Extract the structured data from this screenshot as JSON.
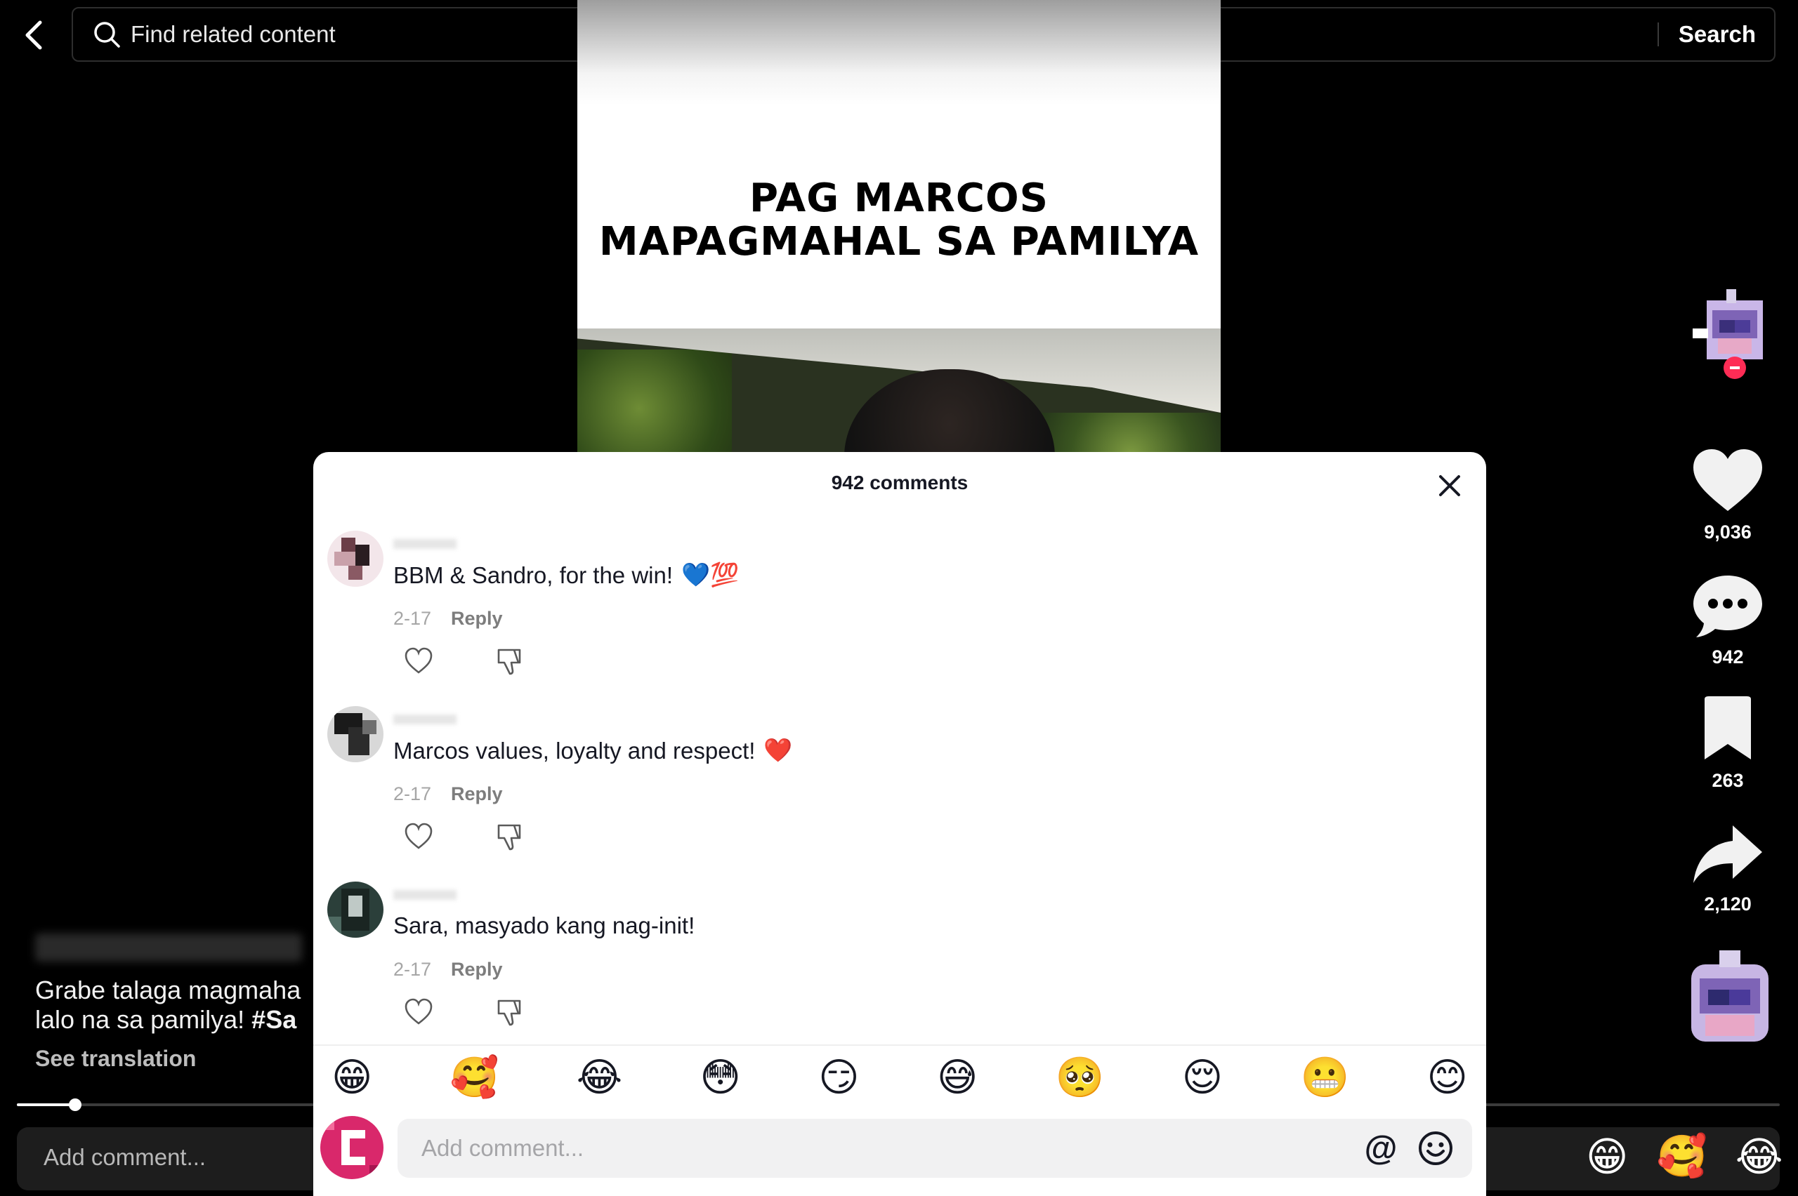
{
  "search": {
    "placeholder": "Find related content",
    "button": "Search"
  },
  "video": {
    "caption_line1": "PAG MARCOS",
    "caption_line2": "MAPAGMAHAL SA PAMILYA"
  },
  "rail": {
    "likes": "9,036",
    "comments": "942",
    "saves": "263",
    "shares": "2,120"
  },
  "post": {
    "description_line1": "Grabe talaga magmaha",
    "description_line2_text": "lalo na sa pamilya! ",
    "description_line2_tag": "#Sa",
    "see_translation": "See translation"
  },
  "bottom": {
    "add_comment": "Add comment...",
    "emojis": [
      "😁",
      "🥰",
      "😂"
    ]
  },
  "comments_panel": {
    "title": "942 comments",
    "comments": [
      {
        "text": "BBM & Sandro, for the win!",
        "emoji": "💙💯",
        "date": "2-17",
        "reply": "Reply"
      },
      {
        "text": "Marcos values, loyalty and respect!",
        "emoji": "❤️",
        "date": "2-17",
        "reply": "Reply"
      },
      {
        "text": "Sara, masyado kang nag-init!",
        "emoji": "",
        "date": "2-17",
        "reply": "Reply"
      }
    ],
    "emoji_bar": [
      "😁",
      "🥰",
      "😂",
      "😳",
      "😏",
      "😅",
      "🥺",
      "😌",
      "😬",
      "😊"
    ],
    "input_placeholder": "Add comment..."
  },
  "icons": {
    "back": "chevron-left-icon",
    "search": "search-icon",
    "close": "close-icon",
    "like": "heart-icon",
    "comment": "comment-bubble-icon",
    "save": "bookmark-icon",
    "share": "share-arrow-icon",
    "mention": "at-icon",
    "emoji": "smile-icon"
  }
}
